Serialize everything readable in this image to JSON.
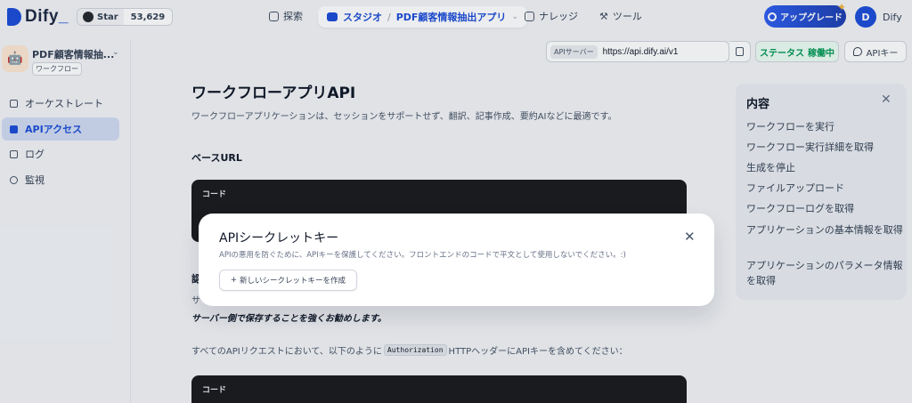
{
  "header": {
    "logo_text": "Dify",
    "github": {
      "star_label": "Star",
      "count": "53,629"
    },
    "nav": {
      "explore": "探索",
      "knowledge": "ナレッジ",
      "tools": "ツール"
    },
    "studio": {
      "label": "スタジオ",
      "separator": "/",
      "app": "PDF顧客情報抽出アプリ"
    },
    "upgrade_label": "アップグレード",
    "user": {
      "initial": "D",
      "name": "Dify"
    }
  },
  "sidebar": {
    "app_name": "PDF顧客情報抽...",
    "app_type": "ワークフロー",
    "items": [
      {
        "label": "オーケストレート",
        "icon": "orchestrate-icon"
      },
      {
        "label": "APIアクセス",
        "icon": "api-icon"
      },
      {
        "label": "ログ",
        "icon": "log-icon"
      },
      {
        "label": "監視",
        "icon": "monitor-icon"
      }
    ]
  },
  "api_bar": {
    "server_label": "APIサーバー",
    "url": "https://api.dify.ai/v1",
    "status_label": "ステータス",
    "status_value": "稼働中",
    "apikey_label": "APIキー"
  },
  "doc": {
    "title": "ワークフローアプリAPI",
    "description": "ワークフローアプリケーションは、セッションをサポートせず、翻訳、記事作成、要約AIなどに最適です。",
    "base_url_heading": "ベースURL",
    "code_label_1": "コード",
    "partial_heading": "認",
    "partial_text": "サ",
    "strong_text": "サーバー側で保存することを強くお勧めします。",
    "auth_prefix": "すべてのAPIリクエストにおいて、以下のように",
    "auth_code": "Authorization",
    "auth_suffix": "HTTPヘッダーにAPIキーを含めてください：",
    "code_label_2": "コード"
  },
  "toc": {
    "title": "内容",
    "items": [
      "ワークフローを実行",
      "ワークフロー実行詳細を取得",
      "生成を停止",
      "ファイルアップロード",
      "ワークフローログを取得",
      "アプリケーションの基本情報を取得",
      "アプリケーションのパラメータ情報を取得"
    ]
  },
  "modal": {
    "title": "APIシークレットキー",
    "description": "APIの悪用を防ぐために、APIキーを保護してください。フロントエンドのコードで平文として使用しないでください。:)",
    "create_label": "新しいシークレットキーを作成",
    "create_prefix": "+"
  }
}
